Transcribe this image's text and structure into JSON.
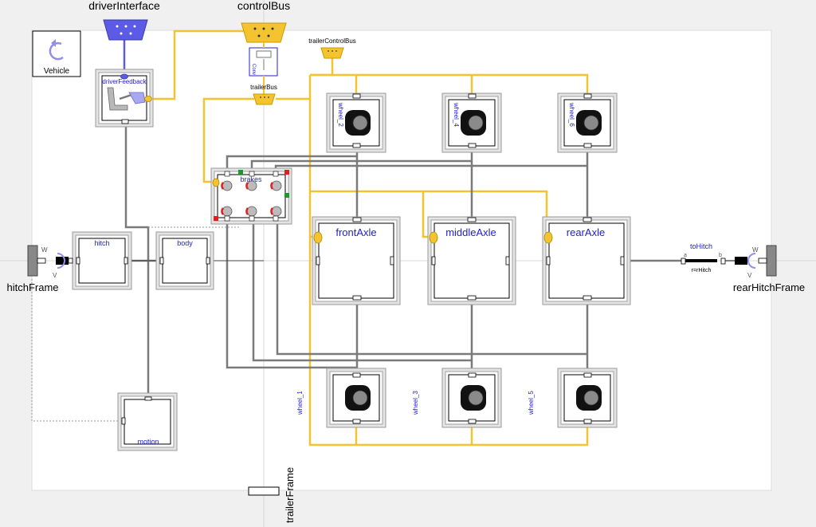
{
  "diagram": {
    "top_labels": {
      "driver_interface": "driverInterface",
      "control_bus": "controlBus",
      "trailer_control_bus": "trailerControlBus",
      "trailer_bus": "trailerBus"
    },
    "vehicle_icon_label": "Vehicle",
    "blocks": {
      "driver_feedback": "driverFeedback",
      "brakes": "brakes",
      "hitch": "hitch",
      "body": "body",
      "motion": "motion",
      "front_axle": "frontAxle",
      "middle_axle": "middleAxle",
      "rear_axle": "rearAxle"
    },
    "wheels": [
      "wheel_2",
      "wheel_4",
      "wheel_6",
      "wheel_1",
      "wheel_3",
      "wheel_5"
    ],
    "to_hitch": {
      "name": "toHitch",
      "a": "a",
      "b": "b",
      "param": "r=rHitch"
    },
    "frames": {
      "hitch_frame": "hitchFrame",
      "rear_hitch_frame": "rearHitchFrame",
      "trailer_frame": "trailerFrame"
    },
    "frame_axes": {
      "w": "W",
      "v": "V"
    },
    "conv_label": "Conv",
    "colors": {
      "bus_yellow": "#f4c430",
      "bus_blue": "#5b5be6",
      "connection_gray": "#7a7a7a",
      "label_blue": "#2222cc",
      "indicator_green": "#1a9a2a",
      "indicator_red": "#e02020"
    }
  }
}
